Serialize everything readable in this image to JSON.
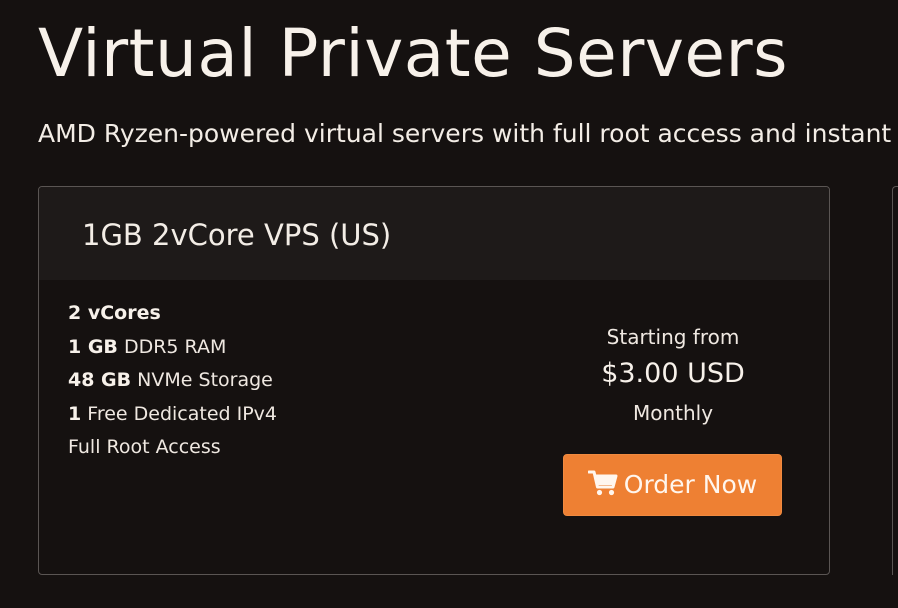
{
  "header": {
    "title": "Virtual Private Servers",
    "subtitle": "AMD Ryzen-powered virtual servers with full root access and instant setup."
  },
  "plan": {
    "name": "1GB 2vCore VPS (US)",
    "features": [
      {
        "bold": "2 vCores",
        "text": ""
      },
      {
        "bold": "1 GB",
        "text": " DDR5 RAM"
      },
      {
        "bold": "48 GB",
        "text": " NVMe Storage"
      },
      {
        "bold": "1",
        "text": " Free Dedicated IPv4"
      },
      {
        "bold": "",
        "text": "Full Root Access"
      }
    ],
    "pricing": {
      "starting_label": "Starting from",
      "price": "$3.00 USD",
      "cycle": "Monthly"
    },
    "order_button": {
      "label": "Order Now",
      "icon": "shopping-cart-icon"
    }
  },
  "colors": {
    "background": "#151110",
    "card_header": "#1e1a19",
    "accent": "#ee8033",
    "text": "#f3ede6"
  }
}
